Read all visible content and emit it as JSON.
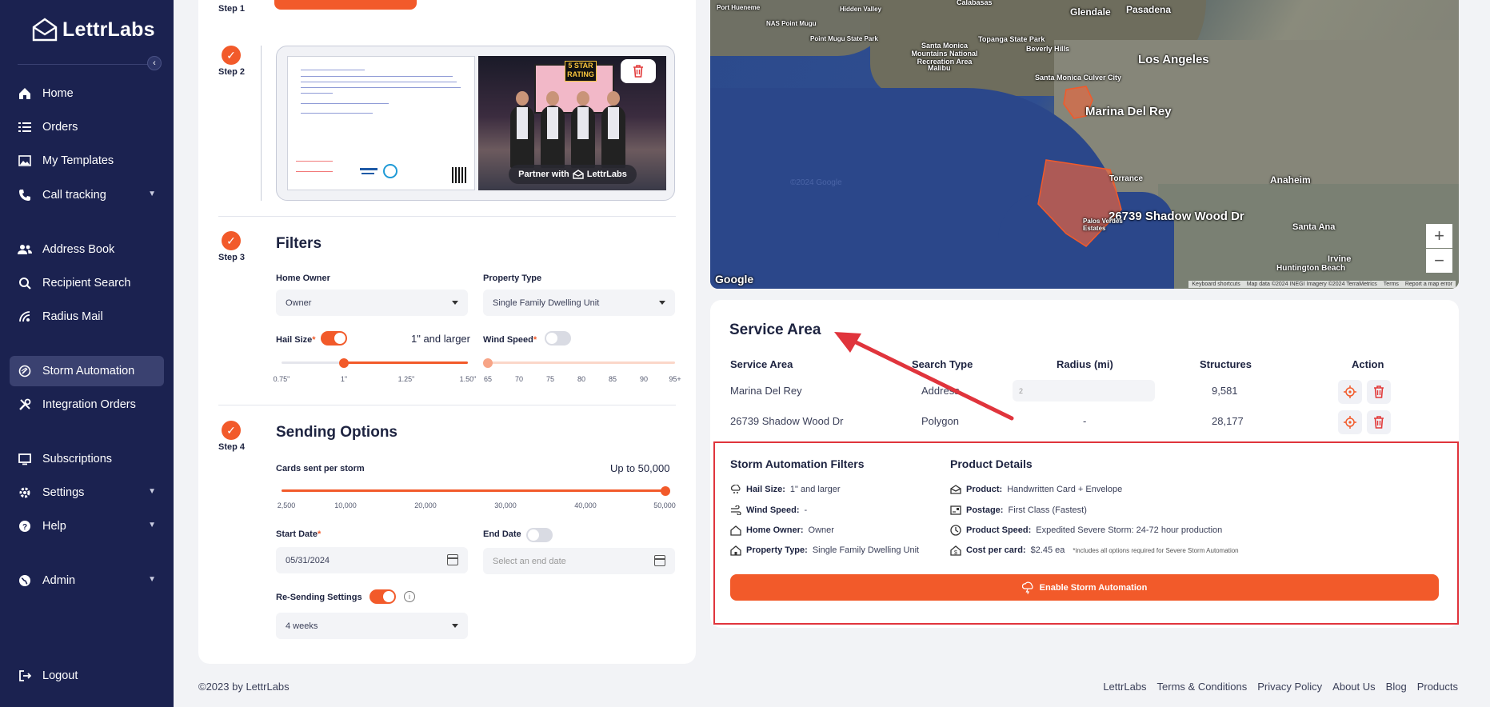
{
  "brand": {
    "name": "LettrLabs"
  },
  "sidebar": {
    "items": [
      {
        "label": "Home",
        "icon": "home-icon"
      },
      {
        "label": "Orders",
        "icon": "list-icon"
      },
      {
        "label": "My Templates",
        "icon": "image-icon"
      },
      {
        "label": "Call tracking",
        "icon": "phone-icon"
      },
      {
        "label": "Address Book",
        "icon": "users-icon"
      },
      {
        "label": "Recipient Search",
        "icon": "search-icon"
      },
      {
        "label": "Radius Mail",
        "icon": "radius-icon"
      },
      {
        "label": "Storm Automation",
        "icon": "storm-icon"
      },
      {
        "label": "Integration Orders",
        "icon": "tools-icon"
      },
      {
        "label": "Subscriptions",
        "icon": "monitor-icon"
      },
      {
        "label": "Settings",
        "icon": "gear-icon"
      },
      {
        "label": "Help",
        "icon": "help-icon"
      },
      {
        "label": "Admin",
        "icon": "globe-icon"
      },
      {
        "label": "Logout",
        "icon": "logout-icon"
      }
    ]
  },
  "steps": {
    "step1": "Step 1",
    "step2": "Step 2",
    "step3": "Step 3",
    "step4": "Step 4"
  },
  "preview": {
    "partner_text": "Partner with",
    "partner_brand": "LettrLabs",
    "badge": "5 STAR RATING"
  },
  "filters": {
    "title": "Filters",
    "home_owner_label": "Home Owner",
    "home_owner_value": "Owner",
    "property_type_label": "Property Type",
    "property_type_value": "Single Family Dwelling Unit",
    "hail_size_label": "Hail Size",
    "hail_size_value": "1\" and larger",
    "hail_size_fraction": 0.333,
    "hail_ticks": [
      "0.75\"",
      "1\"",
      "1.25\"",
      "1.50\""
    ],
    "wind_speed_label": "Wind Speed",
    "wind_ticks": [
      "65",
      "70",
      "75",
      "80",
      "85",
      "90",
      "95+"
    ],
    "required_mark": "*"
  },
  "sending": {
    "title": "Sending Options",
    "cards_label": "Cards sent per storm",
    "cards_value": "Up to 50,000",
    "cards_fraction": 1.0,
    "cards_ticks": [
      "2,500",
      "10,000",
      "20,000",
      "30,000",
      "40,000",
      "50,000"
    ],
    "start_date_label": "Start Date",
    "start_date_value": "05/31/2024",
    "end_date_label": "End Date",
    "end_date_placeholder": "Select an end date",
    "resend_label": "Re-Sending Settings",
    "resend_value": "4 weeks"
  },
  "map": {
    "labels": {
      "portmeneme": "Port Hueneme",
      "naspoint": "NAS Point Mugu",
      "pointmugu": "Point Mugu State Park",
      "calabasas": "Calabasas",
      "hidden": "Hidden Valley",
      "glendale": "Glendale",
      "pasadena": "Pasadena",
      "topanga": "Topanga State Park",
      "montains": "Santa Monica Mountains National Recreation Area",
      "malibu": "Malibu",
      "beverly": "Beverly Hills",
      "la": "Los Angeles",
      "smcc": "Santa Monica Culver City",
      "marina": "Marina Del Rey",
      "shadow": "26739 Shadow Wood Dr",
      "torrance": "Torrance",
      "anaheim": "Anaheim",
      "santaana": "Santa Ana",
      "irvine": "Irvine",
      "huntington": "Huntington Beach",
      "palos": "Palos Verdes Estates",
      "copyright": "©2024 Google"
    },
    "google": "Google",
    "attribution": [
      "Keyboard shortcuts",
      "Map data ©2024 INEGI Imagery ©2024 TerraMetrics",
      "Terms",
      "Report a map error"
    ],
    "zoom_in": "+",
    "zoom_out": "−"
  },
  "service_area": {
    "title": "Service Area",
    "columns": [
      "Service Area",
      "Search Type",
      "Radius (mi)",
      "Structures",
      "Action"
    ],
    "rows": [
      {
        "area": "Marina Del Rey",
        "type": "Address",
        "radius": "2",
        "structures": "9,581"
      },
      {
        "area": "26739 Shadow Wood Dr",
        "type": "Polygon",
        "radius": "-",
        "structures": "28,177"
      }
    ]
  },
  "automation_filters": {
    "title": "Storm Automation Filters",
    "items": [
      {
        "label": "Hail Size:",
        "value": "1\" and larger"
      },
      {
        "label": "Wind Speed:",
        "value": "-"
      },
      {
        "label": "Home Owner:",
        "value": "Owner"
      },
      {
        "label": "Property Type:",
        "value": "Single Family Dwelling Unit"
      }
    ]
  },
  "product_details": {
    "title": "Product Details",
    "items": [
      {
        "label": "Product:",
        "value": "Handwritten Card + Envelope"
      },
      {
        "label": "Postage:",
        "value": "First Class (Fastest)"
      },
      {
        "label": "Product Speed:",
        "value": "Expedited Severe Storm: 24-72 hour production"
      },
      {
        "label": "Cost per card:",
        "value": "$2.45 ea"
      }
    ],
    "note": "*includes all options required for Severe Storm Automation"
  },
  "enable_button": "Enable Storm Automation",
  "footer": {
    "copyright": "©2023 by LettrLabs",
    "links": [
      "LettrLabs",
      "Terms & Conditions",
      "Privacy Policy",
      "About Us",
      "Blog",
      "Products"
    ]
  },
  "colors": {
    "accent": "#f25a2a",
    "sidebar": "#1b2250",
    "highlight": "#e0343c"
  }
}
